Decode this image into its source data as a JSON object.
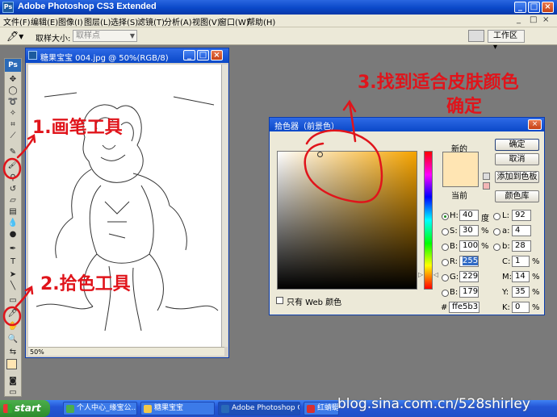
{
  "window": {
    "title": "Adobe Photoshop CS3 Extended",
    "app_icon": "Ps"
  },
  "menubar": {
    "items": [
      "文件(F)",
      "编辑(E)",
      "图像(I)",
      "图层(L)",
      "选择(S)",
      "滤镜(T)",
      "分析(A)",
      "视图(V)",
      "窗口(W)",
      "帮助(H)"
    ]
  },
  "options_bar": {
    "tool_icon": "eyedropper-icon",
    "sample_size_label": "取样大小:",
    "sample_size_value": "取样点",
    "workspace_label": "工作区"
  },
  "toolbox": {
    "logo": "Ps",
    "foreground_color": "#ffe5b3",
    "background_color": "#ffffff"
  },
  "document": {
    "title": "糖果宝宝 004.jpg @ 50%(RGB/8)",
    "zoom": "50%"
  },
  "color_picker": {
    "title": "拾色器（前景色）",
    "new_label": "新的",
    "current_label": "当前",
    "new_color": "#ffe5b3",
    "current_color": "#ffe5b3",
    "buttons": {
      "ok": "确定",
      "cancel": "取消",
      "add_swatch": "添加到色板",
      "libraries": "颜色库"
    },
    "hsb": {
      "h_label": "H:",
      "h": "40",
      "h_unit": "度",
      "s_label": "S:",
      "s": "30",
      "s_unit": "%",
      "b_label": "B:",
      "b": "100",
      "b_unit": "%"
    },
    "rgb": {
      "r_label": "R:",
      "r": "255",
      "g_label": "G:",
      "g": "229",
      "b_label": "B:",
      "b": "179"
    },
    "lab": {
      "l_label": "L:",
      "l": "92",
      "a_label": "a:",
      "a": "4",
      "b_label": "b:",
      "b": "28"
    },
    "cmyk": {
      "c_label": "C:",
      "c": "1",
      "m_label": "M:",
      "m": "14",
      "y_label": "Y:",
      "y": "35",
      "k_label": "K:",
      "k": "0",
      "unit": "%"
    },
    "hex_label": "#",
    "hex": "ffe5b3",
    "web_only_label": "只有 Web 颜色",
    "web_only_checked": false
  },
  "annotations": {
    "step1": "1.画笔工具",
    "step2": "2.拾色工具",
    "step3_line1": "3.找到适合皮肤颜色",
    "step3_line2": "确定",
    "color": "#e0141b"
  },
  "taskbar": {
    "start": "start",
    "items": [
      "个人中心_缘宝公...",
      "糖果宝宝",
      "Adobe Photoshop C...",
      "红蜻蜓..."
    ]
  },
  "watermark": "blog.sina.com.cn/528shirley"
}
